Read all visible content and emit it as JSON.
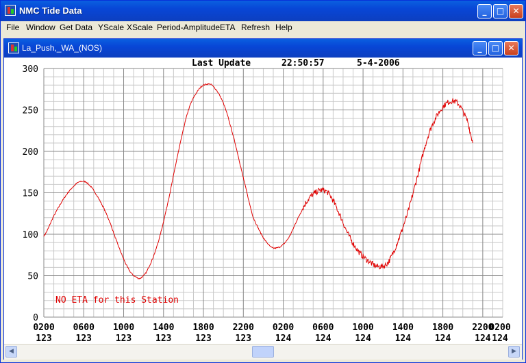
{
  "window": {
    "title": "NMC Tide Data",
    "minimize_glyph": "_",
    "maximize_glyph": "□",
    "close_glyph": "✕"
  },
  "menu": [
    "File",
    "Window",
    "Get Data",
    "YScale",
    "XScale",
    "Period-Amplitude",
    "ETA",
    "Refresh",
    "Help"
  ],
  "child_window": {
    "title": "La_Push,_WA_(NOS)",
    "minimize_glyph": "_",
    "maximize_glyph": "□",
    "close_glyph": "✕"
  },
  "header": {
    "last_update_label": "Last Update",
    "time": "22:50:57",
    "date": "5-4-2006"
  },
  "notice": "NO ETA for this Station",
  "colors": {
    "trace": "#e00000",
    "notice": "#e00000",
    "grid": "#8a8a8a",
    "grid_minor": "#c8c8c8"
  },
  "chart_data": {
    "type": "line",
    "ylim": [
      0,
      300
    ],
    "y_ticks": [
      0,
      50,
      100,
      150,
      200,
      250,
      300
    ],
    "x_range_hours": [
      2,
      48
    ],
    "x_ticks": [
      {
        "time": "0200",
        "day": "123"
      },
      {
        "time": "0600",
        "day": "123"
      },
      {
        "time": "1000",
        "day": "123"
      },
      {
        "time": "1400",
        "day": "123"
      },
      {
        "time": "1800",
        "day": "123"
      },
      {
        "time": "2200",
        "day": "123"
      },
      {
        "time": "0200",
        "day": "124"
      },
      {
        "time": "0600",
        "day": "124"
      },
      {
        "time": "1000",
        "day": "124"
      },
      {
        "time": "1400",
        "day": "124"
      },
      {
        "time": "1800",
        "day": "124"
      },
      {
        "time": "2200",
        "day": "124"
      },
      {
        "time": "0200",
        "day": "124"
      }
    ],
    "series": [
      {
        "x": [
          2,
          3,
          4,
          5,
          5.8,
          6.5,
          7.5,
          8.5,
          9.5,
          10.5,
          11.3,
          11.8,
          12.5,
          13.5,
          14.5,
          15.5,
          16.5,
          17.5,
          18.3,
          19,
          20,
          21,
          22,
          23,
          24.5,
          25.5,
          26.5,
          27.5,
          28.5,
          29.5,
          30,
          30.6,
          31.5,
          32.5,
          33.5,
          34.5,
          35.5,
          36.5,
          37.5,
          38.5,
          39.5,
          40.5,
          41.5,
          42.5,
          43.5,
          44.5,
          45
        ],
        "y": [
          98,
          122,
          143,
          158,
          164,
          160,
          143,
          118,
          85,
          58,
          48,
          48,
          60,
          92,
          142,
          200,
          250,
          274,
          281,
          278,
          258,
          218,
          168,
          120,
          88,
          84,
          95,
          120,
          142,
          152,
          153,
          148,
          128,
          100,
          80,
          68,
          61,
          66,
          92,
          127,
          172,
          218,
          245,
          259,
          258,
          236,
          212
        ],
        "noisy_from_hour": 28
      }
    ]
  },
  "x_labels_note_omitted": false
}
